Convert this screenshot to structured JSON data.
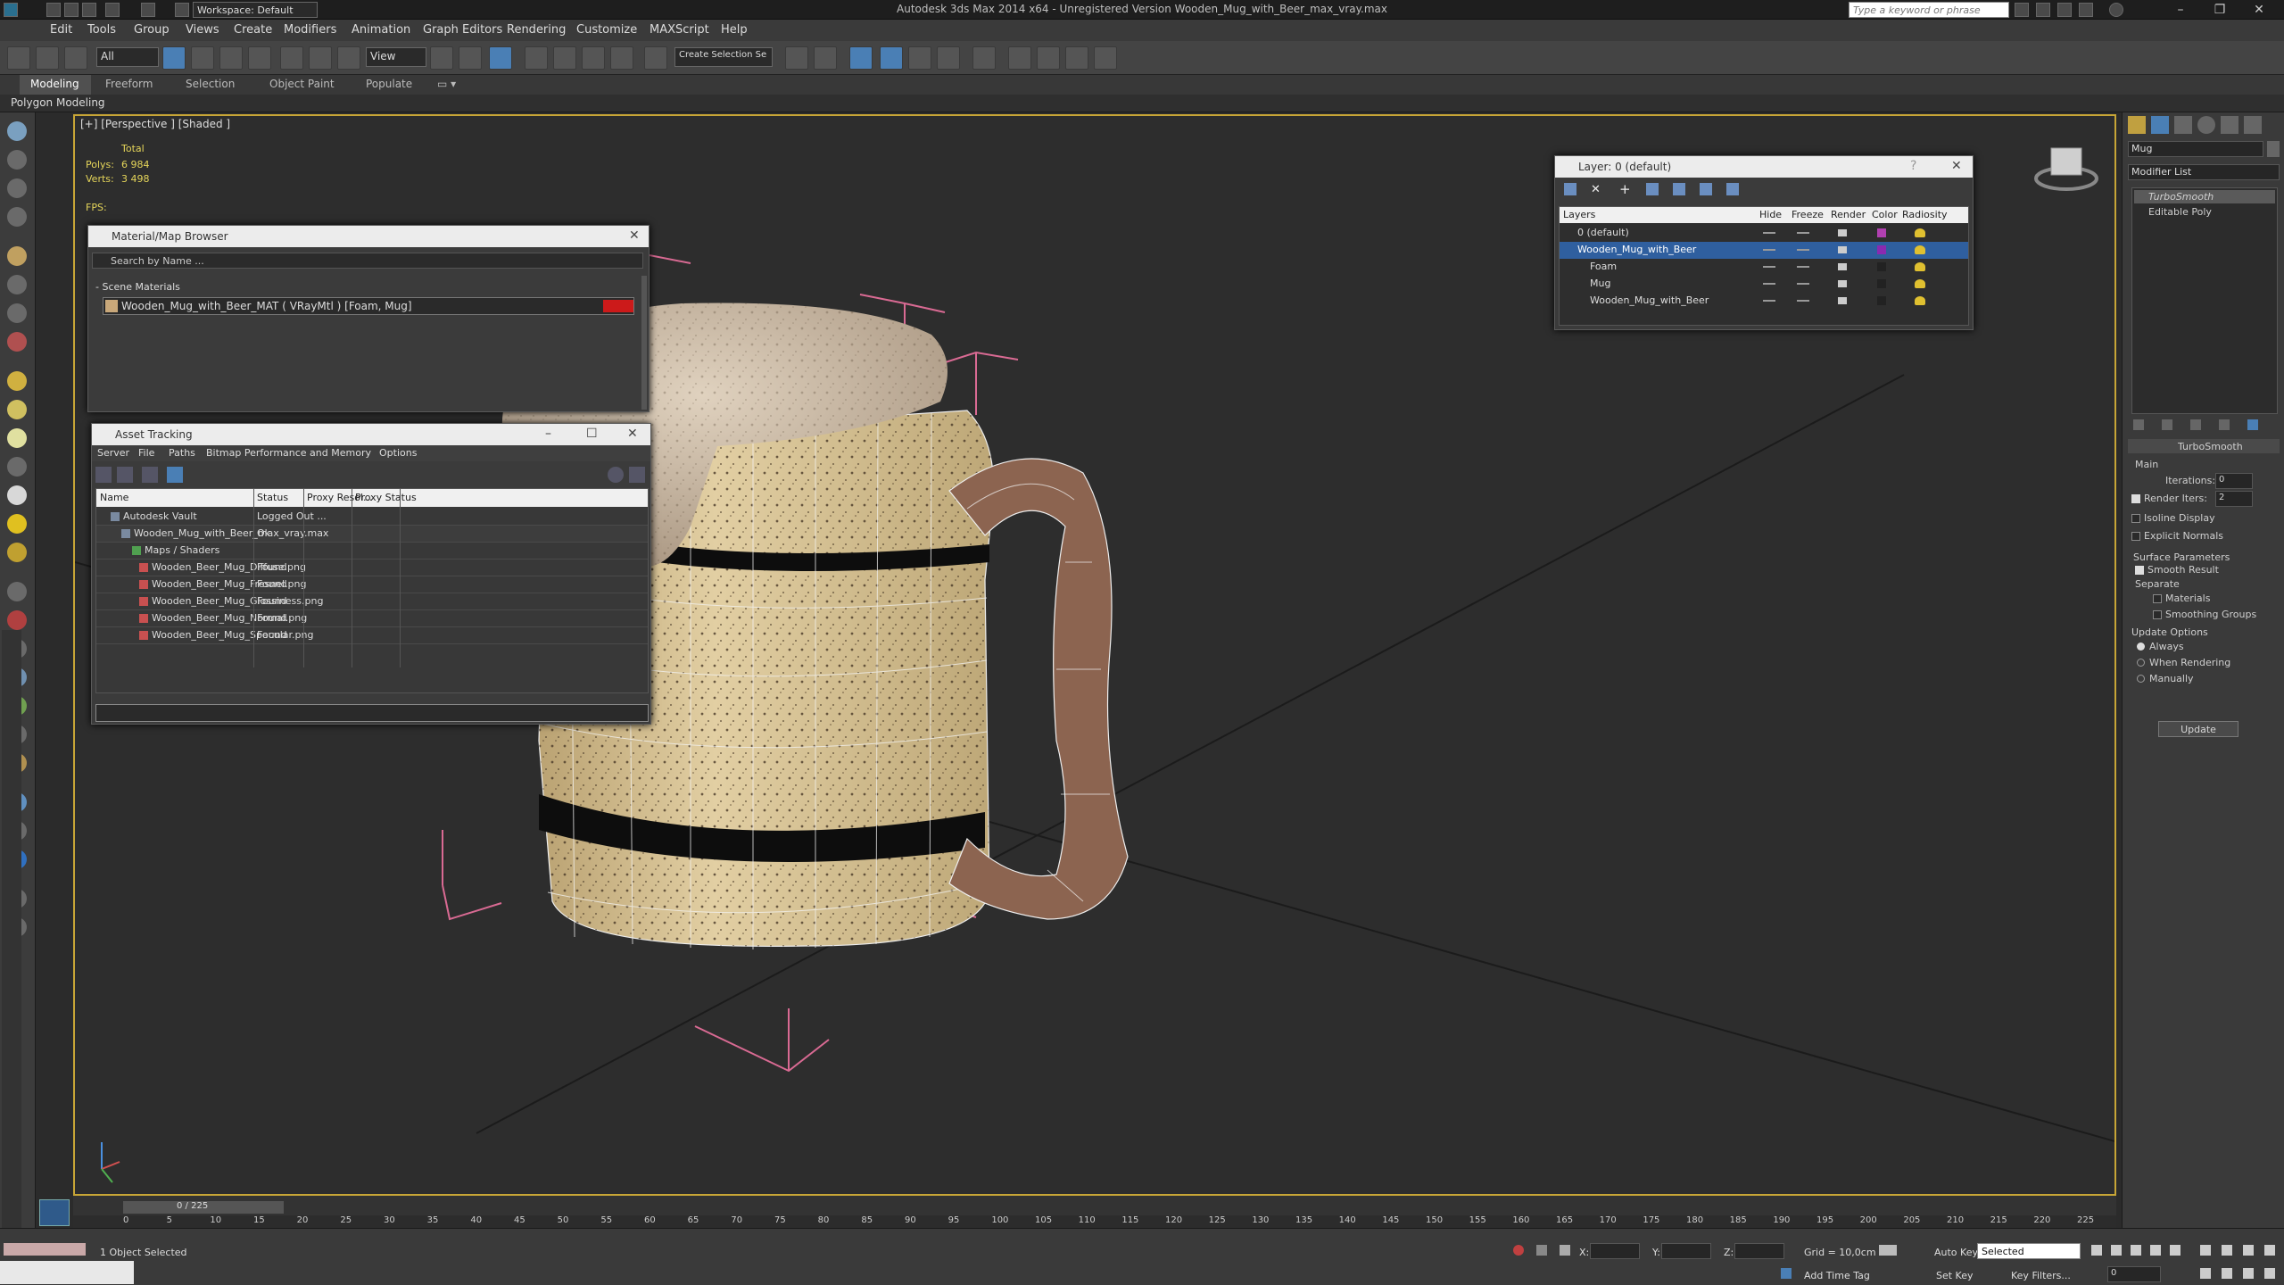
{
  "window": {
    "workspace": "Workspace: Default",
    "title": "Autodesk 3ds Max  2014 x64  -  Unregistered Version   Wooden_Mug_with_Beer_max_vray.max",
    "search_placeholder": "Type a keyword or phrase"
  },
  "menu": [
    "Edit",
    "Tools",
    "Group",
    "Views",
    "Create",
    "Modifiers",
    "Animation",
    "Graph Editors",
    "Rendering",
    "Customize",
    "MAXScript",
    "Help"
  ],
  "toolbar": {
    "filter": "All",
    "ref_coord": "View",
    "selection_set": "Create Selection Se"
  },
  "ribbon": {
    "tabs": [
      "Modeling",
      "Freeform",
      "Selection",
      "Object Paint",
      "Populate"
    ],
    "subtab": "Polygon Modeling"
  },
  "viewport": {
    "label": "[+] [Perspective ] [Shaded ]",
    "stats": {
      "total": "Total",
      "polys_label": "Polys:",
      "polys": "6 984",
      "verts_label": "Verts:",
      "verts": "3 498",
      "fps": "FPS:"
    }
  },
  "material_browser": {
    "title": "Material/Map Browser",
    "search_placeholder": "Search by Name ...",
    "section": "- Scene Materials",
    "item": "Wooden_Mug_with_Beer_MAT  ( VRayMtl ) [Foam, Mug]"
  },
  "asset_tracking": {
    "title": "Asset Tracking",
    "menu": [
      "Server",
      "File",
      "Paths",
      "Bitmap Performance and Memory",
      "Options"
    ],
    "columns": [
      "Name",
      "Status",
      "Proxy Resol...",
      "Proxy Status"
    ],
    "rows": [
      {
        "name": "Autodesk Vault",
        "status": "Logged Out ..."
      },
      {
        "name": "Wooden_Mug_with_Beer_max_vray.max",
        "status": "Ok"
      },
      {
        "name": "Maps / Shaders",
        "status": ""
      },
      {
        "name": "Wooden_Beer_Mug_Diffuse.png",
        "status": "Found"
      },
      {
        "name": "Wooden_Beer_Mug_Fresnel.png",
        "status": "Found"
      },
      {
        "name": "Wooden_Beer_Mug_Glossiness.png",
        "status": "Found"
      },
      {
        "name": "Wooden_Beer_Mug_Normal.png",
        "status": "Found"
      },
      {
        "name": "Wooden_Beer_Mug_Specular.png",
        "status": "Found"
      }
    ]
  },
  "layer_dialog": {
    "title": "Layer: 0 (default)",
    "columns": [
      "Layers",
      "Hide",
      "Freeze",
      "Render",
      "Color",
      "Radiosity"
    ],
    "rows": [
      {
        "name": "0 (default)",
        "color": "#b040b0"
      },
      {
        "name": "Wooden_Mug_with_Beer",
        "color": "#8a2ab0"
      },
      {
        "name": "Foam",
        "color": "#222222"
      },
      {
        "name": "Mug",
        "color": "#222222"
      },
      {
        "name": "Wooden_Mug_with_Beer",
        "color": "#222222"
      }
    ]
  },
  "command_panel": {
    "object_name": "Mug",
    "modifier_list": "Modifier List",
    "stack": [
      "TurboSmooth",
      "Editable Poly"
    ],
    "rollout": "TurboSmooth",
    "main": "Main",
    "iterations_label": "Iterations:",
    "iterations": "0",
    "render_iters_label": "Render Iters:",
    "render_iters": "2",
    "isoline": "Isoline Display",
    "explicit": "Explicit Normals",
    "surface": "Surface Parameters",
    "smooth_result": "Smooth Result",
    "separate": "Separate",
    "materials": "Materials",
    "smoothing_groups": "Smoothing Groups",
    "update_options": "Update Options",
    "always": "Always",
    "when_rendering": "When Rendering",
    "manually": "Manually",
    "update": "Update"
  },
  "timeline": {
    "frame": "0 / 225",
    "ticks": [
      "0",
      "5",
      "10",
      "15",
      "20",
      "25",
      "30",
      "35",
      "40",
      "45",
      "50",
      "55",
      "60",
      "65",
      "70",
      "75",
      "80",
      "85",
      "90",
      "95",
      "100",
      "105",
      "110",
      "115",
      "120",
      "125",
      "130",
      "135",
      "140",
      "145",
      "150",
      "155",
      "160",
      "165",
      "170",
      "175",
      "180",
      "185",
      "190",
      "195",
      "200",
      "205",
      "210",
      "215",
      "220",
      "225"
    ]
  },
  "status": {
    "selected": "1 Object Selected",
    "x_label": "X:",
    "y_label": "Y:",
    "z_label": "Z:",
    "grid": "Grid = 10,0cm",
    "add_time_tag": "Add Time Tag",
    "auto_key": "Auto Key",
    "selected_dd": "Selected",
    "set_key": "Set Key",
    "key_filters": "Key Filters...",
    "frame": "0"
  },
  "colors": {
    "accent": "#4a7fb5",
    "viewport_border": "#c7a536",
    "foam": "#c9b49d",
    "wood": "#d8c193"
  }
}
